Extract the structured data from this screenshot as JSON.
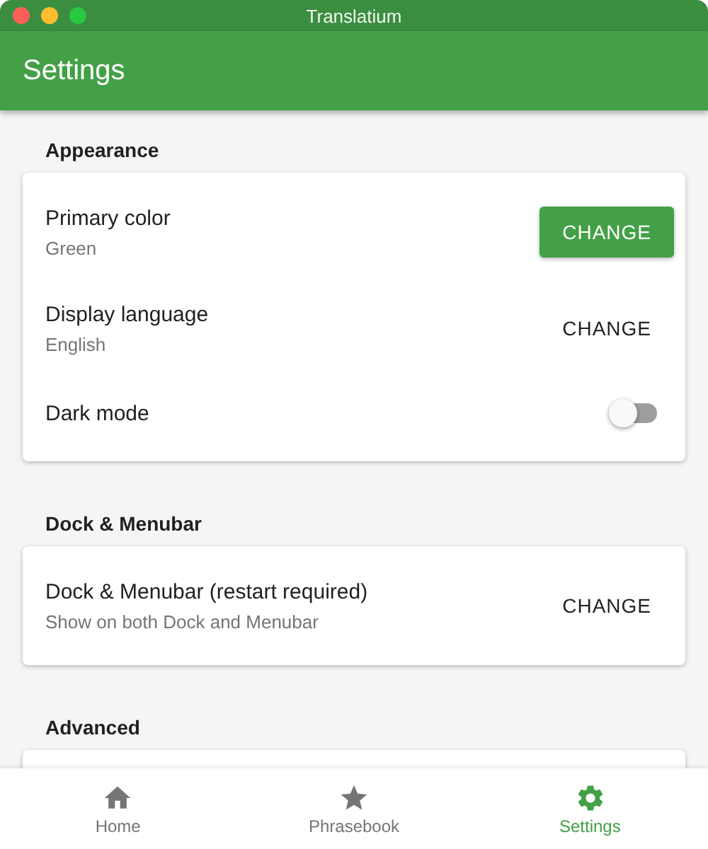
{
  "window": {
    "title": "Translatium"
  },
  "app_bar": {
    "title": "Settings"
  },
  "sections": [
    {
      "title": "Appearance",
      "rows": [
        {
          "kind": "action",
          "title": "Primary color",
          "subtitle": "Green",
          "button": "CHANGE",
          "raised": true
        },
        {
          "kind": "action",
          "title": "Display language",
          "subtitle": "English",
          "button": "CHANGE",
          "raised": false
        },
        {
          "kind": "switch",
          "title": "Dark mode",
          "on": false
        }
      ]
    },
    {
      "title": "Dock & Menubar",
      "rows": [
        {
          "kind": "action",
          "title": "Dock & Menubar (restart required)",
          "subtitle": "Show on both Dock and Menubar",
          "button": "CHANGE",
          "raised": false
        }
      ]
    },
    {
      "title": "Advanced"
    }
  ],
  "bottom_nav": [
    {
      "kind": "home",
      "label": "Home",
      "selected": false
    },
    {
      "kind": "star",
      "label": "Phrasebook",
      "selected": false
    },
    {
      "kind": "settings",
      "label": "Settings",
      "selected": true
    }
  ]
}
